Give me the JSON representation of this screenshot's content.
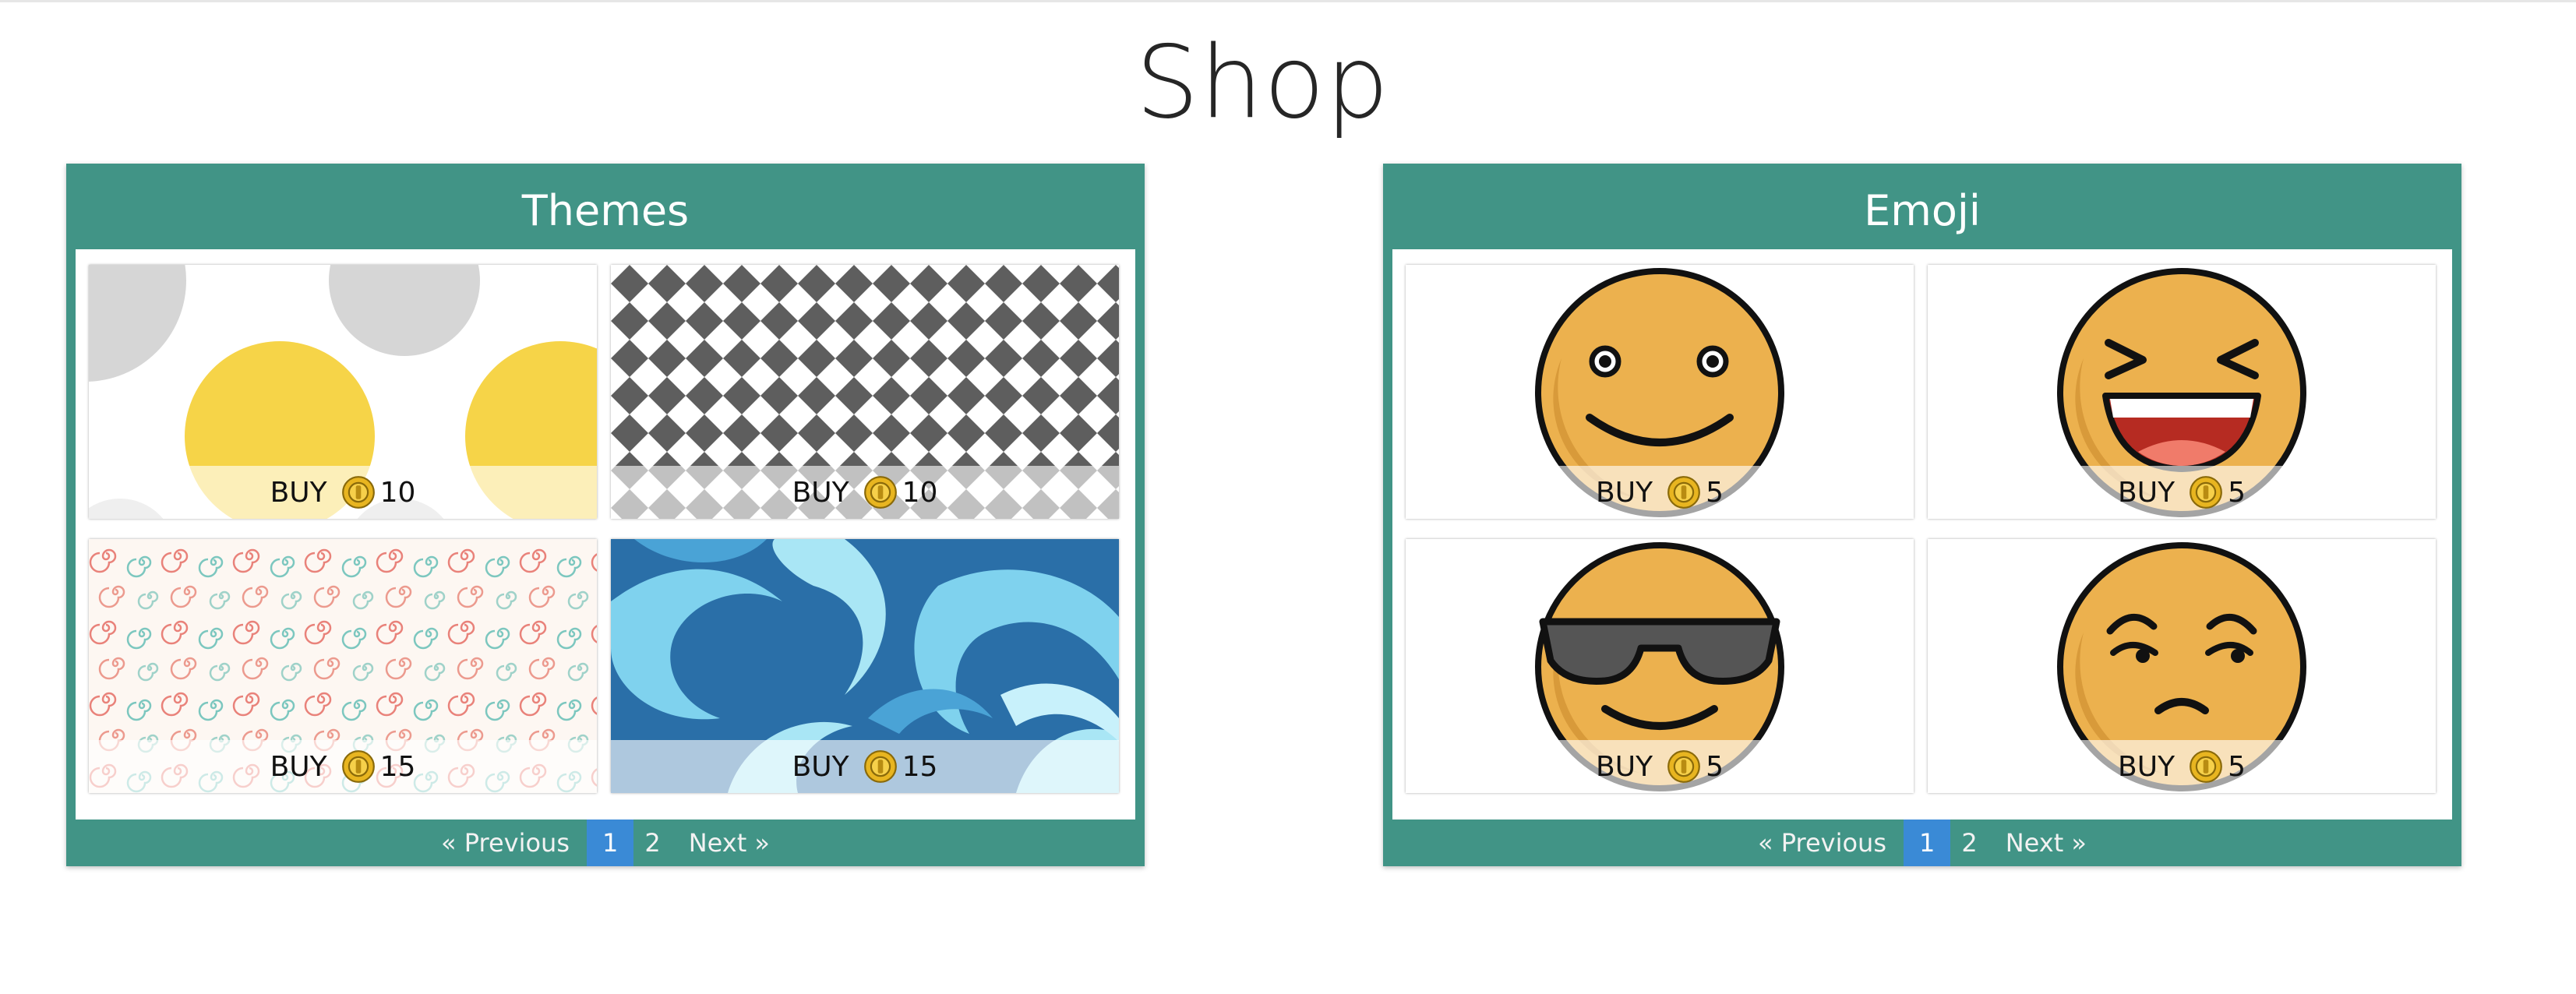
{
  "page": {
    "title": "Shop"
  },
  "themes": {
    "title": "Themes",
    "items": [
      {
        "name": "polka-dots",
        "buy": "BUY",
        "price": "10"
      },
      {
        "name": "checkered",
        "buy": "BUY",
        "price": "10"
      },
      {
        "name": "swirls-pastel",
        "buy": "BUY",
        "price": "15"
      },
      {
        "name": "waves-blue",
        "buy": "BUY",
        "price": "15"
      }
    ],
    "pagination": {
      "prev": "«  Previous",
      "pages": [
        "1",
        "2"
      ],
      "active": "1",
      "next": "Next  »"
    }
  },
  "emoji": {
    "title": "Emoji",
    "items": [
      {
        "name": "smile",
        "buy": "BUY",
        "price": "5"
      },
      {
        "name": "laughing",
        "buy": "BUY",
        "price": "5"
      },
      {
        "name": "sunglasses",
        "buy": "BUY",
        "price": "5"
      },
      {
        "name": "suspicious",
        "buy": "BUY",
        "price": "5"
      }
    ],
    "pagination": {
      "prev": "«  Previous",
      "pages": [
        "1",
        "2"
      ],
      "active": "1",
      "next": "Next  »"
    }
  },
  "colors": {
    "panel": "#419486",
    "active_page": "#3a8ad6",
    "emoji_face": "#ecb14e",
    "coin": "#e8b520"
  }
}
